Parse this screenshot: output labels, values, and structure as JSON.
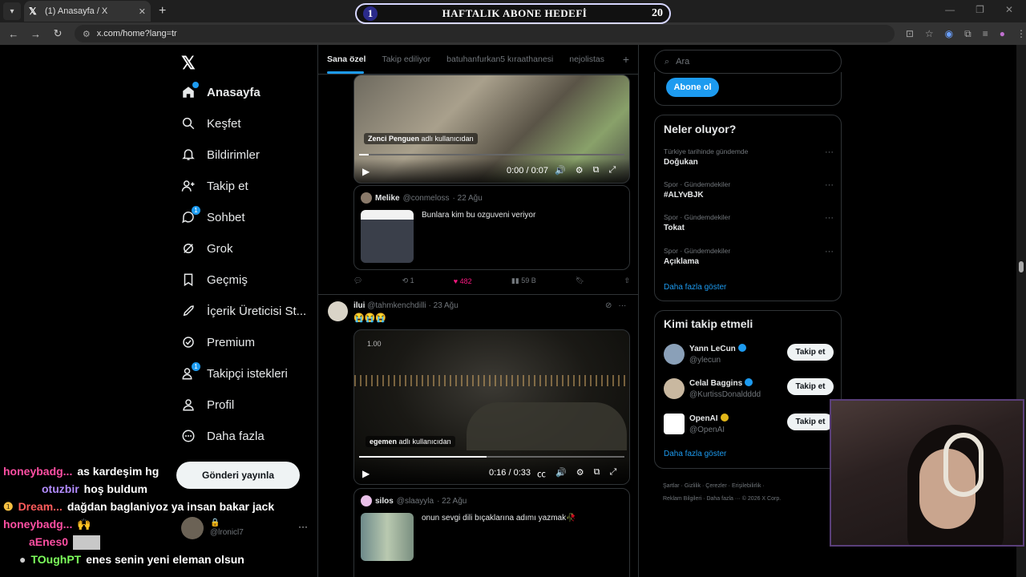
{
  "browser": {
    "tab_title": "(1) Anasayfa / X",
    "url": "x.com/home?lang=tr"
  },
  "goal_overlay": {
    "title": "HAFTALIK ABONE HEDEFİ",
    "current": "1",
    "target": "20"
  },
  "nav": {
    "items": [
      {
        "label": "Anasayfa",
        "icon": "home-icon"
      },
      {
        "label": "Keşfet",
        "icon": "search-icon"
      },
      {
        "label": "Bildirimler",
        "icon": "bell-icon"
      },
      {
        "label": "Takip et",
        "icon": "person-add-icon"
      },
      {
        "label": "Sohbet",
        "icon": "chat-icon",
        "badge": "1"
      },
      {
        "label": "Grok",
        "icon": "grok-icon"
      },
      {
        "label": "Geçmiş",
        "icon": "bookmark-icon"
      },
      {
        "label": "İçerik Üreticisi St...",
        "icon": "rocket-icon"
      },
      {
        "label": "Premium",
        "icon": "verified-icon"
      },
      {
        "label": "Takipçi istekleri",
        "icon": "person-request-icon",
        "badge": "1"
      },
      {
        "label": "Profil",
        "icon": "profile-icon"
      },
      {
        "label": "Daha fazla",
        "icon": "more-circle-icon"
      }
    ],
    "post_button": "Gönderi yayınla",
    "account_handle": "@lronicl7"
  },
  "timeline": {
    "tabs": [
      "Sana özel",
      "Takip ediliyor",
      "batuhanfurkan5 kıraathanesi",
      "nejolistas"
    ],
    "video1": {
      "label_name": "Zenci Penguen",
      "label_suffix": "adlı kullanıcıdan",
      "time": "0:00 / 0:07"
    },
    "quote1": {
      "name": "Melike",
      "handle": "@conmeloss",
      "date": "· 22 Ağu",
      "text": "Bunlara kim bu ozguveni veriyor"
    },
    "actions1": {
      "retweets": "1",
      "likes": "482",
      "views": "59 B"
    },
    "tweet2": {
      "name": "ilui",
      "handle": "@tahmkenchdilli",
      "date": "· 23 Ağu",
      "emoji": "😭😭😭"
    },
    "video2": {
      "speed": "1.00",
      "label_name": "egemen",
      "label_suffix": "adlı kullanıcıdan",
      "time": "0:16 / 0:33",
      "progress": 0.48
    },
    "quote2": {
      "name": "silos",
      "handle": "@slaayyla",
      "date": "· 22 Ağu",
      "text": "onun sevgi dili bıçaklarına adımı yazmak🥀"
    }
  },
  "right": {
    "search_placeholder": "Ara",
    "subscribe_button": "Abone ol",
    "trends_title": "Neler oluyor?",
    "trends": [
      {
        "context": "Türkiye tarihinde gündemde",
        "name": "Doğukan"
      },
      {
        "context": "Spor · Gündemdekiler",
        "name": "#ALYvBJK"
      },
      {
        "context": "Spor · Gündemdekiler",
        "name": "Tokat"
      },
      {
        "context": "Spor · Gündemdekiler",
        "name": "Açıklama"
      }
    ],
    "trends_more": "Daha fazla göster",
    "who_title": "Kimi takip etmeli",
    "who": [
      {
        "name": "Yann LeCun",
        "handle": "@ylecun",
        "button": "Takip et",
        "verified": "blue"
      },
      {
        "name": "Celal Baggins",
        "handle": "@KurtissDonaldddd",
        "button": "Takip et",
        "verified": "blue"
      },
      {
        "name": "OpenAI",
        "handle": "@OpenAI",
        "button": "Takip et",
        "verified": "gold"
      }
    ],
    "who_more": "Daha fazla göster",
    "footer_line1": "Şartlar · Gizlilik · Çerezler · Erişilebilirlik ·",
    "footer_line2": "Reklam Bilgileri · Daha fazla ··· © 2026 X Corp."
  },
  "chat": [
    {
      "user": "honeybadg...",
      "message": "as kardeşim hg",
      "color": "#ff4fa3"
    },
    {
      "user": "otuzbir",
      "message": "hoş buldum",
      "color": "#b28cff"
    },
    {
      "user": "Dream...",
      "message": "dağdan baglaniyoz ya insan bakar jack",
      "color": "#ff5c5c"
    },
    {
      "user": "honeybadg...",
      "message": "🙌",
      "color": "#ff4fa3"
    },
    {
      "user": "aEnes0",
      "message": "",
      "color": "#ff4fa3"
    },
    {
      "user": "TOughPT",
      "message": "enes senin yeni eleman olsun",
      "color": "#7dff5c"
    }
  ]
}
